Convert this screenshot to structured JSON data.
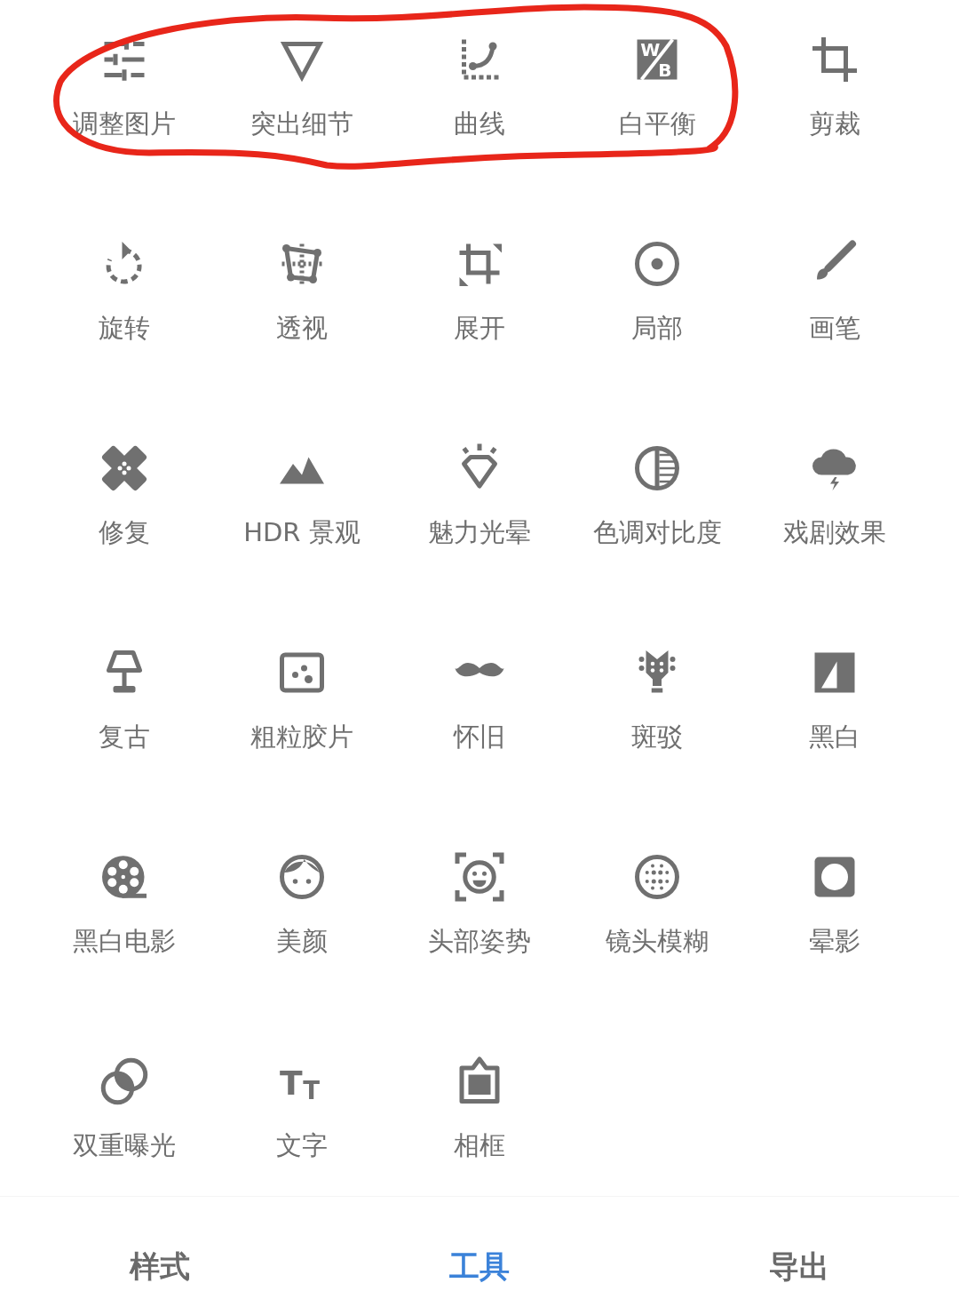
{
  "tools": [
    {
      "label": "调整图片"
    },
    {
      "label": "突出细节"
    },
    {
      "label": "曲线"
    },
    {
      "label": "白平衡",
      "icon_letters": [
        "W",
        "B"
      ]
    },
    {
      "label": "剪裁"
    },
    {
      "label": "旋转"
    },
    {
      "label": "透视"
    },
    {
      "label": "展开"
    },
    {
      "label": "局部"
    },
    {
      "label": "画笔"
    },
    {
      "label": "修复"
    },
    {
      "label": "HDR 景观"
    },
    {
      "label": "魅力光晕"
    },
    {
      "label": "色调对比度"
    },
    {
      "label": "戏剧效果"
    },
    {
      "label": "复古"
    },
    {
      "label": "粗粒胶片"
    },
    {
      "label": "怀旧"
    },
    {
      "label": "斑驳"
    },
    {
      "label": "黑白"
    },
    {
      "label": "黑白电影"
    },
    {
      "label": "美颜"
    },
    {
      "label": "头部姿势"
    },
    {
      "label": "镜头模糊"
    },
    {
      "label": "晕影"
    },
    {
      "label": "双重曝光"
    },
    {
      "label": "文字",
      "icon_letters": [
        "T",
        "T"
      ]
    },
    {
      "label": "相框"
    }
  ],
  "bottom_nav": [
    {
      "label": "样式",
      "selected": false
    },
    {
      "label": "工具",
      "selected": true
    },
    {
      "label": "导出",
      "selected": false
    }
  ]
}
